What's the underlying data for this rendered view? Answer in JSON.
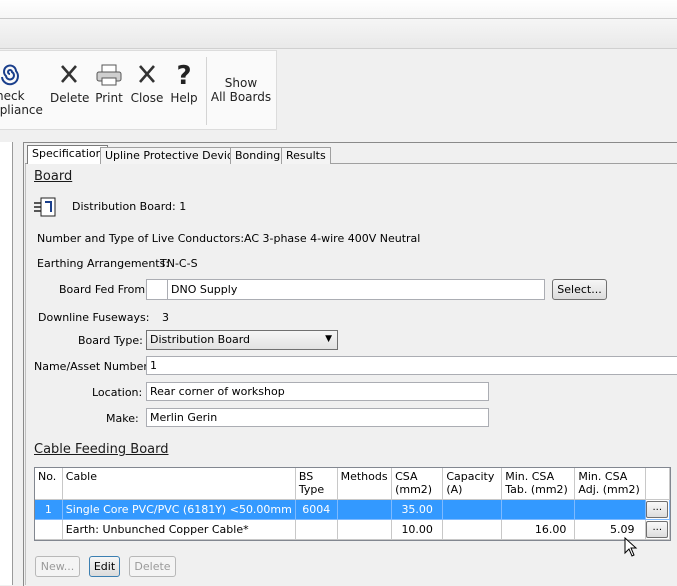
{
  "ribbon": {
    "check_compliance": [
      "heck",
      "mpliance"
    ],
    "delete": "Delete",
    "print": "Print",
    "close": "Close",
    "help": "Help",
    "show_all_boards": [
      "Show",
      "All Boards"
    ]
  },
  "tabs": [
    "Specification",
    "Upline Protective Device",
    "Bonding",
    "Results"
  ],
  "board": {
    "heading": "Board",
    "name": "Distribution Board: 1",
    "live_conductors_label": "Number and Type of Live Conductors:",
    "live_conductors_value": "AC 3-phase 4-wire 400V Neutral",
    "earthing_label": "Earthing Arrangements:",
    "earthing_value": "TN-C-S",
    "fed_from_label": "Board Fed From:",
    "fed_from_value": "DNO Supply",
    "select_button": "Select...",
    "downline_label": "Downline Fuseways:",
    "downline_value": "3",
    "board_type_label": "Board Type:",
    "board_type_value": "Distribution Board",
    "name_asset_label": "Name/Asset Number:",
    "name_asset_value": "1",
    "location_label": "Location:",
    "location_value": "Rear corner of workshop",
    "make_label": "Make:",
    "make_value": "Merlin Gerin"
  },
  "cable": {
    "heading": "Cable Feeding Board",
    "columns": [
      "No.",
      "Cable",
      "BS Type",
      "Methods",
      "CSA (mm2)",
      "Capacity (A)",
      "Min. CSA Tab. (mm2)",
      "Min. CSA Adj. (mm2)"
    ],
    "column_lines": [
      [
        "No."
      ],
      [
        "Cable"
      ],
      [
        "BS",
        "Type"
      ],
      [
        "Methods"
      ],
      [
        "CSA",
        "(mm2)"
      ],
      [
        "Capacity",
        "(A)"
      ],
      [
        "Min. CSA",
        "Tab. (mm2)"
      ],
      [
        "Min. CSA",
        "Adj. (mm2)"
      ]
    ],
    "rows": [
      {
        "no": "1",
        "cable": "Single Core PVC/PVC (6181Y) <50.00mm",
        "bs_type": "6004",
        "methods": "",
        "csa": "35.00",
        "capacity": "",
        "min_tab": "",
        "min_adj": "",
        "selected": true
      },
      {
        "no": "",
        "cable": "Earth: Unbunched Copper Cable*",
        "bs_type": "",
        "methods": "",
        "csa": "10.00",
        "capacity": "",
        "min_tab": "16.00",
        "min_adj": "5.09",
        "selected": false
      }
    ],
    "ellipsis": "...",
    "buttons": {
      "new": "New...",
      "edit": "Edit",
      "delete": "Delete"
    }
  },
  "colors": {
    "selection": "#3399ff",
    "accent": "#1a3f8c"
  },
  "icons": [
    "spiral-icon",
    "delete-x-icon",
    "printer-icon",
    "close-x-icon",
    "help-question-icon",
    "board-icon",
    "dropdown-arrow-icon",
    "mouse-cursor-icon"
  ]
}
